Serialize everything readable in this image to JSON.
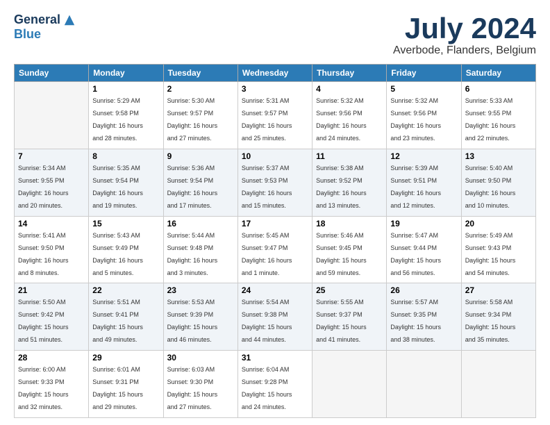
{
  "logo": {
    "general": "General",
    "blue": "Blue"
  },
  "title": "July 2024",
  "subtitle": "Averbode, Flanders, Belgium",
  "columns": [
    "Sunday",
    "Monday",
    "Tuesday",
    "Wednesday",
    "Thursday",
    "Friday",
    "Saturday"
  ],
  "weeks": [
    [
      {
        "day": "",
        "info": ""
      },
      {
        "day": "1",
        "info": "Sunrise: 5:29 AM\nSunset: 9:58 PM\nDaylight: 16 hours\nand 28 minutes."
      },
      {
        "day": "2",
        "info": "Sunrise: 5:30 AM\nSunset: 9:57 PM\nDaylight: 16 hours\nand 27 minutes."
      },
      {
        "day": "3",
        "info": "Sunrise: 5:31 AM\nSunset: 9:57 PM\nDaylight: 16 hours\nand 25 minutes."
      },
      {
        "day": "4",
        "info": "Sunrise: 5:32 AM\nSunset: 9:56 PM\nDaylight: 16 hours\nand 24 minutes."
      },
      {
        "day": "5",
        "info": "Sunrise: 5:32 AM\nSunset: 9:56 PM\nDaylight: 16 hours\nand 23 minutes."
      },
      {
        "day": "6",
        "info": "Sunrise: 5:33 AM\nSunset: 9:55 PM\nDaylight: 16 hours\nand 22 minutes."
      }
    ],
    [
      {
        "day": "7",
        "info": "Sunrise: 5:34 AM\nSunset: 9:55 PM\nDaylight: 16 hours\nand 20 minutes."
      },
      {
        "day": "8",
        "info": "Sunrise: 5:35 AM\nSunset: 9:54 PM\nDaylight: 16 hours\nand 19 minutes."
      },
      {
        "day": "9",
        "info": "Sunrise: 5:36 AM\nSunset: 9:54 PM\nDaylight: 16 hours\nand 17 minutes."
      },
      {
        "day": "10",
        "info": "Sunrise: 5:37 AM\nSunset: 9:53 PM\nDaylight: 16 hours\nand 15 minutes."
      },
      {
        "day": "11",
        "info": "Sunrise: 5:38 AM\nSunset: 9:52 PM\nDaylight: 16 hours\nand 13 minutes."
      },
      {
        "day": "12",
        "info": "Sunrise: 5:39 AM\nSunset: 9:51 PM\nDaylight: 16 hours\nand 12 minutes."
      },
      {
        "day": "13",
        "info": "Sunrise: 5:40 AM\nSunset: 9:50 PM\nDaylight: 16 hours\nand 10 minutes."
      }
    ],
    [
      {
        "day": "14",
        "info": "Sunrise: 5:41 AM\nSunset: 9:50 PM\nDaylight: 16 hours\nand 8 minutes."
      },
      {
        "day": "15",
        "info": "Sunrise: 5:43 AM\nSunset: 9:49 PM\nDaylight: 16 hours\nand 5 minutes."
      },
      {
        "day": "16",
        "info": "Sunrise: 5:44 AM\nSunset: 9:48 PM\nDaylight: 16 hours\nand 3 minutes."
      },
      {
        "day": "17",
        "info": "Sunrise: 5:45 AM\nSunset: 9:47 PM\nDaylight: 16 hours\nand 1 minute."
      },
      {
        "day": "18",
        "info": "Sunrise: 5:46 AM\nSunset: 9:45 PM\nDaylight: 15 hours\nand 59 minutes."
      },
      {
        "day": "19",
        "info": "Sunrise: 5:47 AM\nSunset: 9:44 PM\nDaylight: 15 hours\nand 56 minutes."
      },
      {
        "day": "20",
        "info": "Sunrise: 5:49 AM\nSunset: 9:43 PM\nDaylight: 15 hours\nand 54 minutes."
      }
    ],
    [
      {
        "day": "21",
        "info": "Sunrise: 5:50 AM\nSunset: 9:42 PM\nDaylight: 15 hours\nand 51 minutes."
      },
      {
        "day": "22",
        "info": "Sunrise: 5:51 AM\nSunset: 9:41 PM\nDaylight: 15 hours\nand 49 minutes."
      },
      {
        "day": "23",
        "info": "Sunrise: 5:53 AM\nSunset: 9:39 PM\nDaylight: 15 hours\nand 46 minutes."
      },
      {
        "day": "24",
        "info": "Sunrise: 5:54 AM\nSunset: 9:38 PM\nDaylight: 15 hours\nand 44 minutes."
      },
      {
        "day": "25",
        "info": "Sunrise: 5:55 AM\nSunset: 9:37 PM\nDaylight: 15 hours\nand 41 minutes."
      },
      {
        "day": "26",
        "info": "Sunrise: 5:57 AM\nSunset: 9:35 PM\nDaylight: 15 hours\nand 38 minutes."
      },
      {
        "day": "27",
        "info": "Sunrise: 5:58 AM\nSunset: 9:34 PM\nDaylight: 15 hours\nand 35 minutes."
      }
    ],
    [
      {
        "day": "28",
        "info": "Sunrise: 6:00 AM\nSunset: 9:33 PM\nDaylight: 15 hours\nand 32 minutes."
      },
      {
        "day": "29",
        "info": "Sunrise: 6:01 AM\nSunset: 9:31 PM\nDaylight: 15 hours\nand 29 minutes."
      },
      {
        "day": "30",
        "info": "Sunrise: 6:03 AM\nSunset: 9:30 PM\nDaylight: 15 hours\nand 27 minutes."
      },
      {
        "day": "31",
        "info": "Sunrise: 6:04 AM\nSunset: 9:28 PM\nDaylight: 15 hours\nand 24 minutes."
      },
      {
        "day": "",
        "info": ""
      },
      {
        "day": "",
        "info": ""
      },
      {
        "day": "",
        "info": ""
      }
    ]
  ]
}
